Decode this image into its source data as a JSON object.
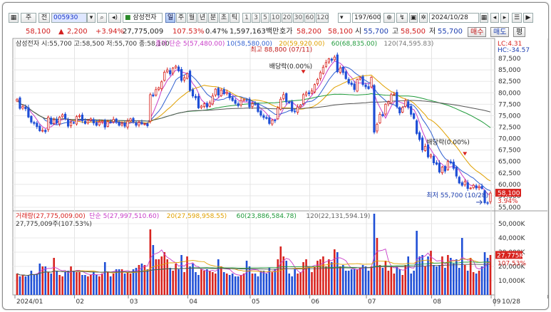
{
  "toolbar": {
    "market_btn": "주",
    "range_btn": "전",
    "code": "005930",
    "name": "삼성전자",
    "period_tabs": [
      "일",
      "주",
      "월",
      "년",
      "분",
      "초",
      "틱"
    ],
    "active_tab": "일",
    "minute_options": [
      "1",
      "3",
      "5",
      "10",
      "20",
      "30",
      "60",
      "120"
    ],
    "count": "197",
    "count_total": "/600",
    "date": "2024/10/28"
  },
  "quote": {
    "price": "58,100",
    "change_arrow": "▲",
    "change": "2,200",
    "change_pct": "+3.94%",
    "volume": "27,775,009",
    "volume_ratio": "107.53%",
    "turnover_rate": "0.47%",
    "trade_value": "1,597,163백만",
    "bid_label": "호가",
    "bid": "58,200",
    "ask": "58,100",
    "open_label": "시",
    "open": "55,700",
    "high_label": "고",
    "high": "58,500",
    "low_label": "저",
    "low": "55,700",
    "buy_btn": "매수",
    "sell_btn": "매도",
    "eval_btn": "평"
  },
  "colors": {
    "up": "#d8231f",
    "down": "#1f4fd6",
    "ma5": "#c83cc8",
    "ma10": "#2f5fd0",
    "ma20": "#e0a000",
    "ma60": "#1f9a3a",
    "ma120": "#555555",
    "bg": "#ffffff",
    "grid": "#e8e8e8"
  },
  "chart_data": [
    {
      "type": "candlestick",
      "legend": "삼성전자 시:55,700 고:58,500 저:55,700 종:58,100",
      "ma_legend": [
        {
          "name": "종가 단순 5(57,480.00)",
          "color": "#c83cc8"
        },
        {
          "name": "10(58,580.00)",
          "color": "#2f5fd0"
        },
        {
          "name": "20(59,920.00)",
          "color": "#e0a000"
        },
        {
          "name": "60(68,835.00)",
          "color": "#1f9a3a"
        },
        {
          "name": "120(74,595.83)",
          "color": "#777777"
        }
      ],
      "x_months": [
        "2024/01",
        "02",
        "03",
        "04",
        "05",
        "06",
        "07",
        "08",
        "09",
        "10"
      ],
      "x_last": "10/28",
      "ylim": [
        55000,
        90000
      ],
      "y_ticks": [
        55000,
        57500,
        60000,
        62500,
        65000,
        67500,
        70000,
        72500,
        75000,
        77500,
        80000,
        82500,
        85000,
        87500
      ],
      "y_tick_labels": [
        "55,000",
        "57,500",
        "60,000",
        "62,500",
        "65,000",
        "67,500",
        "70,000",
        "72,500",
        "75,000",
        "77,500",
        "80,000",
        "82,500",
        "85,000",
        "87,500"
      ],
      "last_price_label": "58,100",
      "last_pct_label": "3.94%",
      "lc_label": "LC:4.31",
      "hc_label": "HC:-34.57",
      "annotations": {
        "high": "최고 88,800 (07/11)",
        "low": "최저 55,700 (10/28)",
        "div1": "배당락(0.00%)",
        "div2": "배당락(0.00%)",
        "div3": "배당락(0.00%)"
      },
      "close": [
        78600,
        76600,
        77000,
        76500,
        74700,
        73600,
        73300,
        72600,
        71700,
        71800,
        71500,
        74700,
        73200,
        74100,
        73400,
        74700,
        75200,
        74300,
        72700,
        73500,
        73400,
        74800,
        75000,
        73900,
        73300,
        74000,
        74300,
        73400,
        72900,
        73600,
        73800,
        72500,
        73700,
        73600,
        74200,
        73700,
        72900,
        73300,
        72700,
        73800,
        74300,
        73600,
        72900,
        73500,
        73200,
        73200,
        72800,
        79600,
        79300,
        80700,
        81100,
        82400,
        84500,
        85000,
        84100,
        85400,
        85800,
        84800,
        82700,
        83300,
        84200,
        80500,
        79300,
        78900,
        76700,
        77100,
        77600,
        76900,
        77800,
        79300,
        80800,
        79500,
        80600,
        79800,
        80100,
        78900,
        78300,
        77700,
        77200,
        78300,
        78500,
        78400,
        76900,
        77600,
        77400,
        75900,
        75100,
        74600,
        74400,
        73300,
        74000,
        73900,
        76700,
        78600,
        79600,
        78000,
        77800,
        76000,
        75900,
        76900,
        77300,
        79600,
        80000,
        79800,
        80400,
        81800,
        82900,
        84400,
        85600,
        86600,
        87400,
        87100,
        87800,
        84600,
        85400,
        84400,
        83100,
        82100,
        81800,
        80700,
        82900,
        83300,
        81800,
        81300,
        80900,
        83400,
        71400,
        73100,
        75300,
        75000,
        77500,
        78000,
        79600,
        79700,
        77000,
        75600,
        76800,
        78300,
        76800,
        75300,
        74400,
        71100,
        69800,
        67500,
        68300,
        66000,
        66400,
        64700,
        64400,
        62700,
        63800,
        62900,
        65000,
        64700,
        63500,
        61800,
        60300,
        59800,
        60600,
        59100,
        59200,
        59800,
        59200,
        59500,
        59100,
        56000,
        55900,
        58100
      ],
      "volume": [
        15,
        13,
        14,
        13,
        14,
        17,
        14,
        15,
        22,
        20,
        20,
        16,
        15,
        26,
        17,
        14,
        13,
        16,
        17,
        20,
        17,
        16,
        16,
        14,
        14,
        13,
        14,
        16,
        14,
        13,
        15,
        23,
        16,
        13,
        15,
        18,
        18,
        18,
        15,
        16,
        15,
        18,
        19,
        21,
        22,
        21,
        18,
        46,
        35,
        25,
        25,
        27,
        30,
        25,
        19,
        17,
        22,
        18,
        28,
        16,
        27,
        20,
        22,
        16,
        14,
        18,
        17,
        18,
        17,
        16,
        15,
        25,
        20,
        16,
        15,
        14,
        15,
        13,
        13,
        14,
        15,
        24,
        20,
        15,
        15,
        13,
        17,
        17,
        15,
        19,
        16,
        18,
        25,
        34,
        27,
        24,
        15,
        13,
        18,
        15,
        16,
        23,
        25,
        20,
        16,
        20,
        24,
        25,
        27,
        20,
        25,
        23,
        32,
        30,
        20,
        21,
        17,
        17,
        18,
        18,
        18,
        19,
        21,
        20,
        17,
        20,
        57,
        40,
        21,
        19,
        24,
        17,
        20,
        15,
        20,
        18,
        14,
        21,
        27,
        15,
        17,
        45,
        27,
        28,
        20,
        27,
        31,
        21,
        20,
        21,
        27,
        19,
        28,
        26,
        22,
        25,
        19,
        40,
        21,
        17,
        26,
        16,
        15,
        17,
        20,
        30,
        26,
        28
      ],
      "volume_unit": "만주",
      "volume_legend": [
        {
          "name": "거래량(27,775,009.00)",
          "color": "#d8231f"
        },
        {
          "name": "단순 5(27,997,510.60)",
          "color": "#c83cc8"
        },
        {
          "name": "20(27,598,958.55)",
          "color": "#e0a000"
        },
        {
          "name": "60(23,886,584.78)",
          "color": "#1f9a3a"
        },
        {
          "name": "120(22,131,594.19)",
          "color": "#666666"
        }
      ],
      "volume_sub": "27,775,009주(107.53%)",
      "volume_ticks": [
        10000,
        20000,
        30000,
        40000,
        50000
      ],
      "volume_tick_labels": [
        "10,000K",
        "20,000K",
        "30,000K",
        "40,000K",
        "50,000K"
      ],
      "volume_last_label": "27,775K",
      "volume_last_pct": "107.53%"
    }
  ]
}
